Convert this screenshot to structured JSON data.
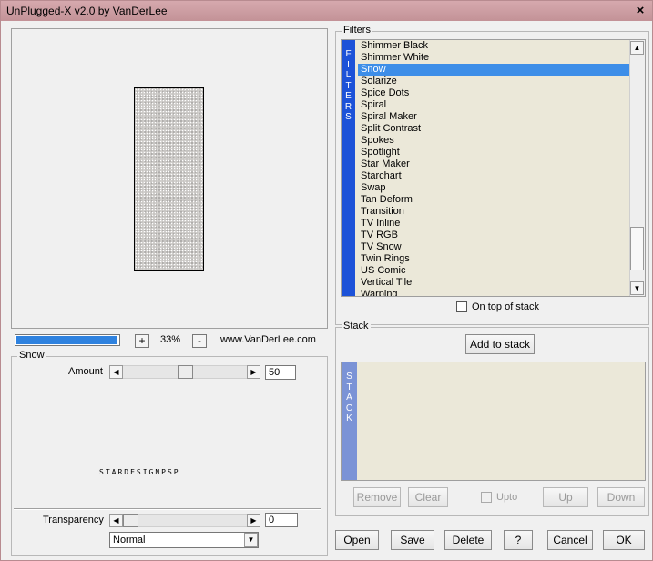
{
  "window": {
    "title": "UnPlugged-X v2.0 by VanDerLee",
    "close_glyph": "×"
  },
  "preview": {
    "progress_percent": 100,
    "zoom_minus": "-",
    "zoom_plus": "+",
    "zoom_value": "33%",
    "website": "www.VanDerLee.com"
  },
  "effect_panel": {
    "title": "Snow",
    "amount_label": "Amount",
    "amount_value": "50",
    "watermark_text": "STARDESIGNPSP",
    "transparency_label": "Transparency",
    "transparency_value": "0",
    "blend_mode": "Normal"
  },
  "filters": {
    "group_title": "Filters",
    "tab_letters": [
      "F",
      "I",
      "L",
      "T",
      "E",
      "R",
      "S"
    ],
    "items": [
      "Shimmer Black",
      "Shimmer White",
      "Snow",
      "Solarize",
      "Spice Dots",
      "Spiral",
      "Spiral Maker",
      "Split Contrast",
      "Spokes",
      "Spotlight",
      "Star Maker",
      "Starchart",
      "Swap",
      "Tan Deform",
      "Transition",
      "TV Inline",
      "TV RGB",
      "TV Snow",
      "Twin Rings",
      "US Comic",
      "Vertical Tile",
      "Warping"
    ],
    "selected": "Snow",
    "on_top_label": "On top of stack"
  },
  "stack": {
    "group_title": "Stack",
    "add_button": "Add to stack",
    "tab_letters": [
      "S",
      "T",
      "A",
      "C",
      "K"
    ],
    "remove": "Remove",
    "clear": "Clear",
    "upto": "Upto",
    "up": "Up",
    "down": "Down"
  },
  "footer": {
    "open": "Open",
    "save": "Save",
    "delete": "Delete",
    "help": "?",
    "cancel": "Cancel",
    "ok": "OK"
  },
  "icons": {
    "scroll_up": "▲",
    "scroll_down": "▼",
    "scroll_left": "◀",
    "scroll_right": "▶",
    "dropdown": "▼"
  },
  "colors": {
    "titlebar": "#c59398",
    "filters_tab": "#1c52d8",
    "stack_tab": "#7b93d6",
    "selection": "#3d8ee8",
    "progress": "#2f82df",
    "list_bg": "#ebe8d9"
  }
}
